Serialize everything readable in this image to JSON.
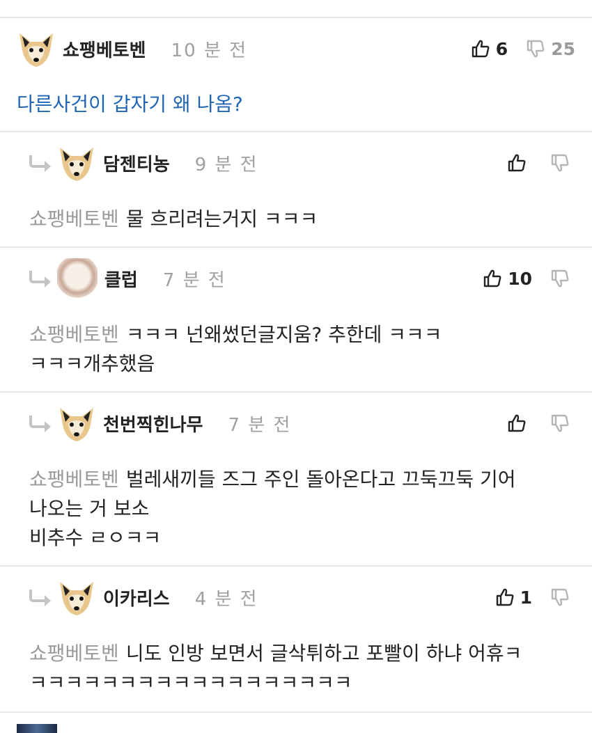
{
  "comments": [
    {
      "nick": "쇼팽베토벤",
      "time": "10 분 전",
      "up": "6",
      "down": "25",
      "text": "다른사건이 갑자기 왜 나옴?"
    },
    {
      "nick": "담젠티농",
      "time": "9 분 전",
      "up": "",
      "down": "",
      "mention": "쇼팽베토벤",
      "line1": "물 흐리려는거지 ㅋㅋㅋ"
    },
    {
      "nick": "클럽",
      "time": "7 분 전",
      "up": "10",
      "down": "",
      "mention": "쇼팽베토벤",
      "line1": "ㅋㅋㅋ 넌왜썼던글지움? 추한데 ㅋㅋㅋ",
      "line2": "ㅋㅋㅋ개추했음"
    },
    {
      "nick": "천번찍힌나무",
      "time": "7 분 전",
      "up": "",
      "down": "",
      "mention": "쇼팽베토벤",
      "line1": "벌레새끼들 즈그 주인 돌아온다고 끄둑끄둑 기어",
      "line2": "나오는 거 보소",
      "line3": "비추수 ㄹㅇㅋㅋ"
    },
    {
      "nick": "이카리스",
      "time": "4 분 전",
      "up": "1",
      "down": "",
      "mention": "쇼팽베토벤",
      "line1": "니도 인방 보면서 글삭튀하고 포빨이 하냐 어휴ㅋ",
      "line2": "ㅋㅋㅋㅋㅋㅋㅋㅋㅋㅋㅋㅋㅋㅋㅋㅋㅋㅋ"
    }
  ],
  "icons": {
    "thumb_up": "thumbs-up-icon",
    "thumb_down": "thumbs-down-icon",
    "reply": "reply-arrow-icon",
    "avatar": "fox-avatar-icon"
  },
  "colors": {
    "link_blue": "#1f65b3",
    "muted": "#9a9a9a",
    "divider": "#e8e8e8"
  }
}
